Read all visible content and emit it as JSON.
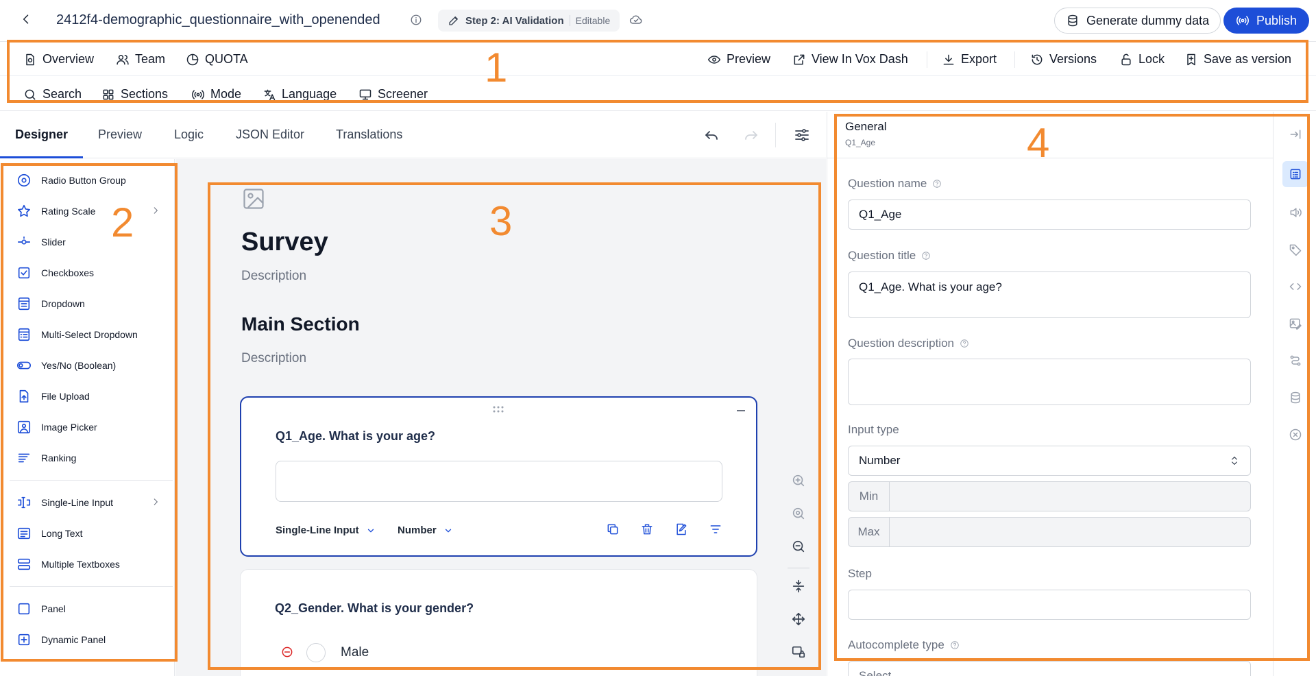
{
  "topbar": {
    "doc_title": "2412f4-demographic_questionnaire_with_openended",
    "step_label": "Step 2: AI Validation",
    "step_state": "Editable",
    "generate_label": "Generate dummy data",
    "publish_label": "Publish"
  },
  "toolbar": {
    "row1_left": [
      "Overview",
      "Team",
      "QUOTA"
    ],
    "row1_right": [
      "Preview",
      "View In Vox Dash",
      "Export",
      "Versions",
      "Lock",
      "Save as version"
    ],
    "row2": [
      "Search",
      "Sections",
      "Mode",
      "Language",
      "Screener"
    ]
  },
  "tabs": [
    "Designer",
    "Preview",
    "Logic",
    "JSON Editor",
    "Translations"
  ],
  "sidebar": {
    "items": [
      {
        "label": "Radio Button Group",
        "icon": "radio-icon"
      },
      {
        "label": "Rating Scale",
        "icon": "star-icon",
        "has_submenu": true
      },
      {
        "label": "Slider",
        "icon": "slider-icon"
      },
      {
        "label": "Checkboxes",
        "icon": "checkbox-icon"
      },
      {
        "label": "Dropdown",
        "icon": "dropdown-icon"
      },
      {
        "label": "Multi-Select Dropdown",
        "icon": "multi-dropdown-icon"
      },
      {
        "label": "Yes/No (Boolean)",
        "icon": "toggle-icon"
      },
      {
        "label": "File Upload",
        "icon": "upload-icon"
      },
      {
        "label": "Image Picker",
        "icon": "image-picker-icon"
      },
      {
        "label": "Ranking",
        "icon": "ranking-icon"
      },
      {
        "label": "Single-Line Input",
        "icon": "text-cursor-icon",
        "has_submenu": true
      },
      {
        "label": "Long Text",
        "icon": "long-text-icon"
      },
      {
        "label": "Multiple Textboxes",
        "icon": "multi-textbox-icon"
      },
      {
        "label": "Panel",
        "icon": "panel-icon"
      },
      {
        "label": "Dynamic Panel",
        "icon": "dynamic-panel-icon"
      }
    ]
  },
  "canvas": {
    "survey_title": "Survey",
    "survey_desc": "Description",
    "section_title": "Main Section",
    "section_desc": "Description",
    "q1": {
      "title": "Q1_Age. What is your age?",
      "type": "Single-Line Input",
      "input_type": "Number"
    },
    "q2": {
      "title": "Q2_Gender. What is your gender?",
      "option1": "Male"
    }
  },
  "props": {
    "title": "General",
    "subtitle": "Q1_Age",
    "question_name_label": "Question name",
    "question_name_value": "Q1_Age",
    "question_title_label": "Question title",
    "question_title_value": "Q1_Age. What is your age?",
    "question_desc_label": "Question description",
    "question_desc_value": "",
    "input_type_label": "Input type",
    "input_type_value": "Number",
    "min_label": "Min",
    "max_label": "Max",
    "step_label": "Step",
    "autocomplete_label": "Autocomplete type",
    "autocomplete_value": "Select..."
  },
  "annotations": [
    "1",
    "2",
    "3",
    "4"
  ],
  "colors": {
    "accent": "#1d4ed8",
    "annotation": "#f28a30"
  }
}
